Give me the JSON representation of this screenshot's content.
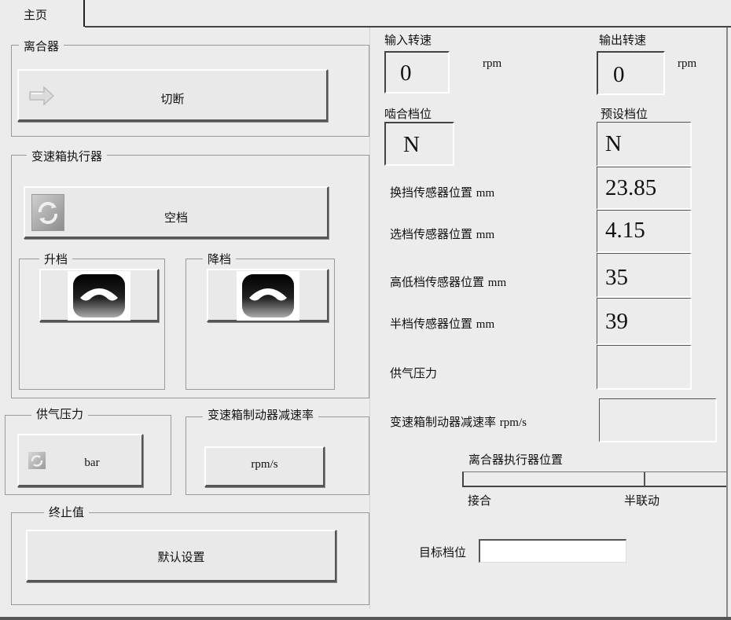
{
  "tab": {
    "label": "主页"
  },
  "clutch": {
    "title": "离合器",
    "button_label": "切断"
  },
  "gearbox_actuator": {
    "title": "变速箱执行器",
    "neutral_label": "空档",
    "upshift_title": "升档",
    "downshift_title": "降档"
  },
  "air_pressure_group": {
    "title": "供气压力",
    "unit": "bar"
  },
  "brake_decel_group": {
    "title": "变速箱制动器减速率",
    "unit": "rpm/s"
  },
  "limit_group": {
    "title": "终止值",
    "button_label": "默认设置"
  },
  "input_speed": {
    "label": "输入转速",
    "value": "0",
    "unit": "rpm"
  },
  "output_speed": {
    "label": "输出转速",
    "value": "0",
    "unit": "rpm"
  },
  "engaged_gear": {
    "label": "啮合档位",
    "value": "N"
  },
  "preset_gear": {
    "label": "预设档位",
    "value": "N"
  },
  "sensors": [
    {
      "label": "换挡传感器位置",
      "unit": "mm",
      "value": "23.85"
    },
    {
      "label": "选档传感器位置",
      "unit": "mm",
      "value": "4.15"
    },
    {
      "label": "高低档传感器位置",
      "unit": "mm",
      "value": "35"
    },
    {
      "label": "半档传感器位置",
      "unit": "mm",
      "value": "39"
    }
  ],
  "air_pressure": {
    "label": "供气压力",
    "value": ""
  },
  "brake_decel": {
    "label": "变速箱制动器减速率",
    "unit": "rpm/s",
    "value": ""
  },
  "clutch_position": {
    "label": "离合器执行器位置",
    "left_label": "接合",
    "mid_label": "半联动"
  },
  "target_gear": {
    "label": "目标档位",
    "value": ""
  }
}
